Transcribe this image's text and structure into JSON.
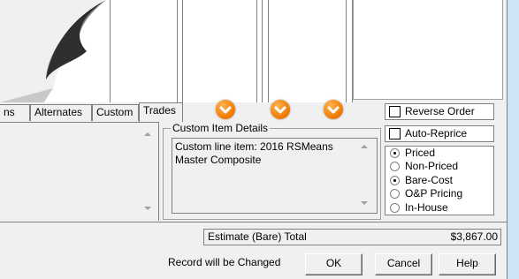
{
  "tabs": [
    "ns",
    "Alternates",
    "Custom",
    "Trades"
  ],
  "custom_item_details": {
    "title": "Custom Item Details",
    "text": "Custom line item: 2016 RSMeans Master Composite"
  },
  "options": {
    "reverse_order": "Reverse Order",
    "auto_reprice": "Auto-Reprice",
    "radios": [
      {
        "label": "Priced",
        "selected": true
      },
      {
        "label": "Non-Priced",
        "selected": false
      },
      {
        "label": "Bare-Cost",
        "selected": true
      },
      {
        "label": "O&P Pricing",
        "selected": false
      },
      {
        "label": "In-House",
        "selected": false
      }
    ]
  },
  "status": {
    "total_label": "Estimate (Bare) Total",
    "total_value": "$3,867.00",
    "record_message": "Record will be Changed"
  },
  "buttons": {
    "ok": "OK",
    "cancel": "Cancel",
    "help": "Help"
  },
  "icons": [
    "down-arrow-icon",
    "down-arrow-icon",
    "down-arrow-icon"
  ],
  "colors": {
    "accent_orange": "#f07800",
    "window_blue": "#cfe3f7"
  }
}
